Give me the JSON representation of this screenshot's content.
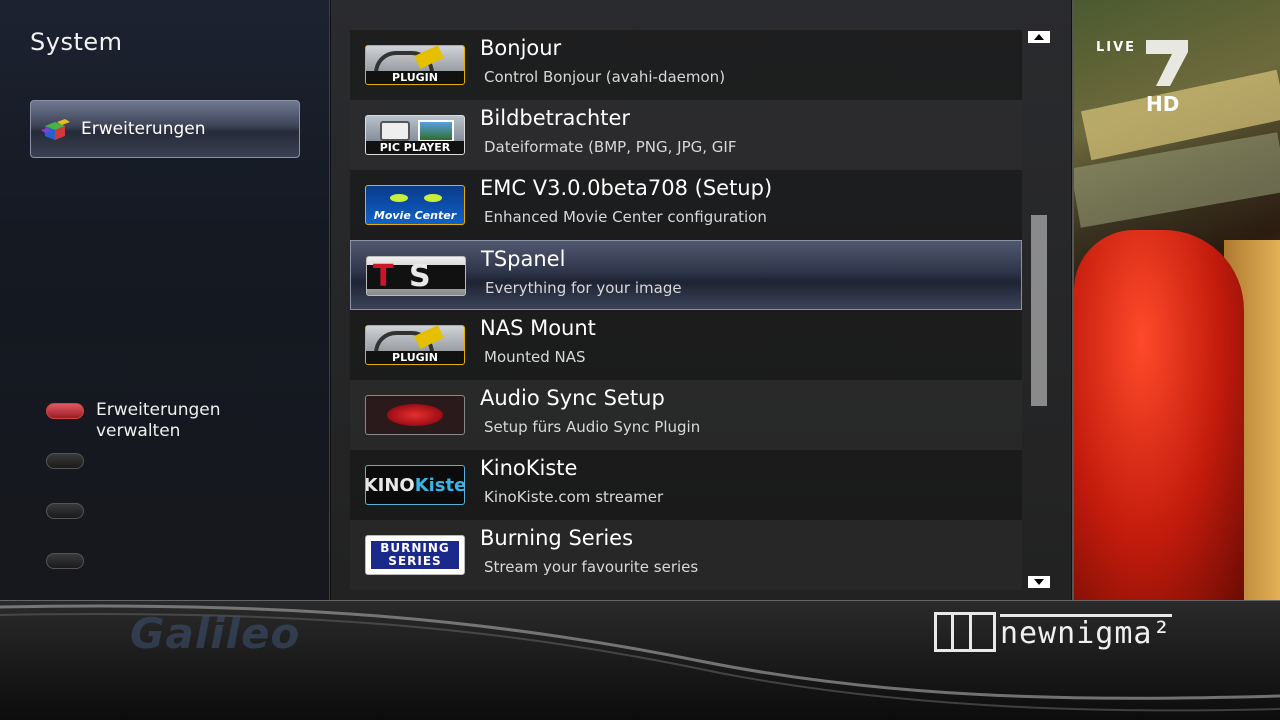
{
  "window": {
    "title": "System"
  },
  "sidebar": {
    "category_label": "Erweiterungen",
    "category_icon": "cubes-icon",
    "color_keys": [
      {
        "color": "red",
        "label": "Erweiterungen verwalten"
      },
      {
        "color": "gray",
        "label": ""
      },
      {
        "color": "gray",
        "label": ""
      },
      {
        "color": "gray",
        "label": ""
      }
    ]
  },
  "plugin_list": {
    "selected_index": 3,
    "items": [
      {
        "title": "Bonjour",
        "description": "Control Bonjour (avahi-daemon)",
        "icon": "plugin-icon",
        "icon_text": "PLUGIN"
      },
      {
        "title": "Bildbetrachter",
        "description": "Dateiformate (BMP, PNG, JPG, GIF",
        "icon": "pic-player-icon",
        "icon_text": "PIC PLAYER"
      },
      {
        "title": "EMC V3.0.0beta708 (Setup)",
        "description": "Enhanced Movie Center configuration",
        "icon": "movie-center-icon",
        "icon_text": "Movie Center"
      },
      {
        "title": "TSpanel",
        "description": "Everything for your image",
        "icon": "tspanel-icon",
        "icon_text": "TS"
      },
      {
        "title": "NAS Mount",
        "description": "Mounted NAS",
        "icon": "plugin-icon",
        "icon_text": "PLUGIN"
      },
      {
        "title": "Audio Sync Setup",
        "description": "Setup fürs Audio Sync Plugin",
        "icon": "lips-icon",
        "icon_text": ""
      },
      {
        "title": "KinoKiste",
        "description": "KinoKiste.com streamer",
        "icon": "kinokiste-icon",
        "icon_text": "KINOKiste",
        "icon_text_a": "KINO",
        "icon_text_b": "Kiste"
      },
      {
        "title": "Burning Series",
        "description": "Stream your favourite series",
        "icon": "burning-series-icon",
        "icon_text": "BURNING SERIES",
        "icon_text_a": "BURNING",
        "icon_text_b": "SERIES"
      }
    ]
  },
  "video": {
    "live_label": "LIVE",
    "hd_label": "HD",
    "channel_logo": "prosieben-seven-icon"
  },
  "footer": {
    "channel_watermark": "Galileo",
    "brand": "newnigma²"
  },
  "colors": {
    "accent_red": "#c0202c",
    "selection": "#3a4156",
    "scrollbar": "#8a8a8a"
  }
}
